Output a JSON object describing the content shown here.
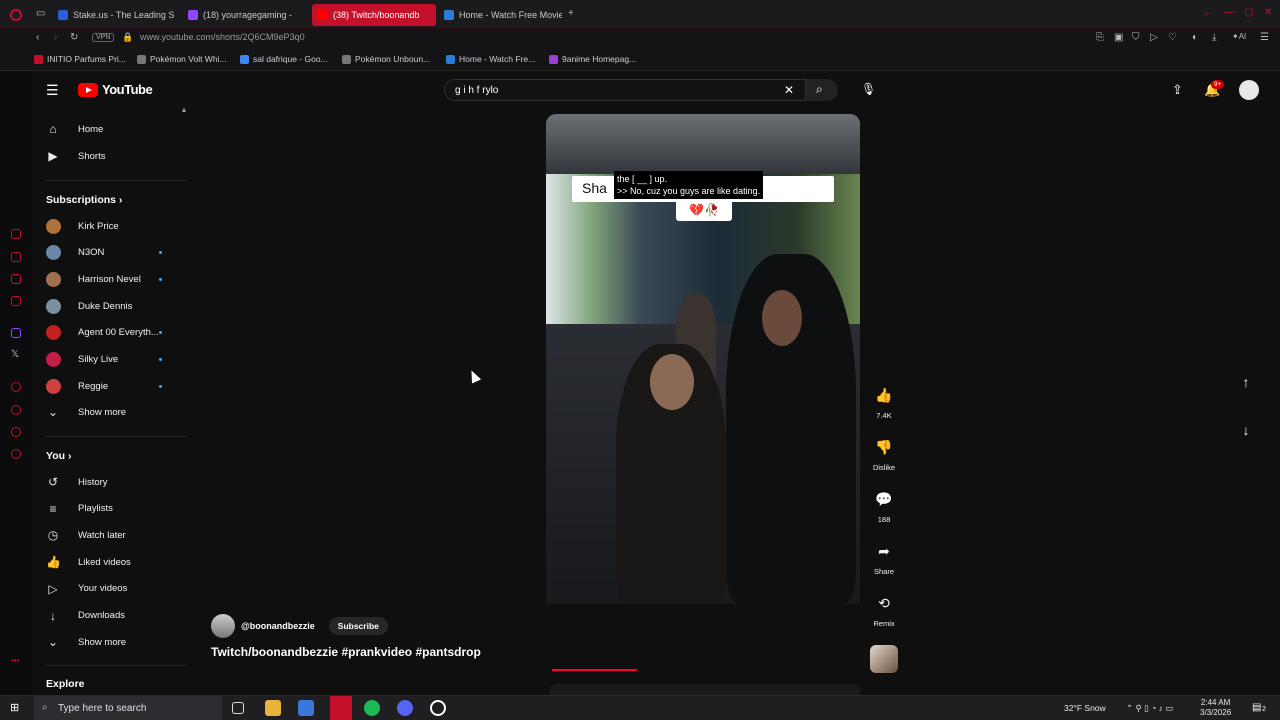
{
  "browser": {
    "tabs": [
      {
        "label": "Stake.us - The Leading So",
        "color": "#2b5fd9"
      },
      {
        "label": "(18) yourragegaming -",
        "color": "#9146ff"
      },
      {
        "label": "(38) Twitch/boonandb",
        "color": "#ff0000",
        "active": true
      },
      {
        "label": "Home - Watch Free Movie",
        "color": "#2b7bd9"
      }
    ],
    "vpn": "VPN",
    "url": "www.youtube.com/shorts/2Q6CM9eP3q0",
    "bookmarks": [
      {
        "label": "INITIO Parfums Pri...",
        "color": "#c4102a"
      },
      {
        "label": "Pokémon Volt Whi...",
        "color": "#777"
      },
      {
        "label": "sal dafrique - Goo...",
        "color": "#4285f4"
      },
      {
        "label": "Pokémon Unboun...",
        "color": "#777"
      },
      {
        "label": "Home - Watch Fre...",
        "color": "#2b7bd9"
      },
      {
        "label": "9anime Homepag...",
        "color": "#9b3fd8"
      }
    ]
  },
  "youtube": {
    "logo": "YouTube",
    "search_value": "g i h f rylo",
    "notif_badge": "9+",
    "sidebar": {
      "top": [
        {
          "label": "Home",
          "icon": "home-icon",
          "glyph": "⌂"
        },
        {
          "label": "Shorts",
          "icon": "shorts-icon",
          "glyph": "▶"
        }
      ],
      "subscriptions_title": "Subscriptions",
      "subscriptions": [
        {
          "label": "Kirk Price",
          "color": "#b0703c",
          "dot": false
        },
        {
          "label": "N3ON",
          "color": "#6a86a8",
          "dot": true
        },
        {
          "label": "Harrison Nevel",
          "color": "#a07050",
          "dot": true
        },
        {
          "label": "Duke Dennis",
          "color": "#7a8fa0",
          "dot": false
        },
        {
          "label": "Agent 00 Everyth...",
          "color": "#c42020",
          "dot": true
        },
        {
          "label": "Silky Live",
          "color": "#c02048",
          "dot": true
        },
        {
          "label": "Reggie",
          "color": "#d04040",
          "dot": true
        }
      ],
      "show_more_1": "Show more",
      "you_title": "You",
      "you_items": [
        {
          "label": "History",
          "icon": "history-icon",
          "glyph": "↺"
        },
        {
          "label": "Playlists",
          "icon": "playlists-icon",
          "glyph": "≡"
        },
        {
          "label": "Watch later",
          "icon": "clock-icon",
          "glyph": "◷"
        },
        {
          "label": "Liked videos",
          "icon": "thumb-up-icon",
          "glyph": "👍"
        },
        {
          "label": "Your videos",
          "icon": "your-videos-icon",
          "glyph": "▷"
        },
        {
          "label": "Downloads",
          "icon": "download-icon",
          "glyph": "↓"
        }
      ],
      "show_more_2": "Show more",
      "explore_title": "Explore"
    },
    "video": {
      "caption_line1": "the [ __ ] up.",
      "caption_line2": ">> No, cuz you guys are like dating.",
      "overlay_text": "Sha",
      "emoji_text": "💔🥀",
      "channel": "@boonandbezzie",
      "subscribe": "Subscribe",
      "title": "Twitch/boonandbezzie #prankvideo #pantsdrop",
      "progress": 0.27
    },
    "actions": {
      "likes": "7.4K",
      "dislike": "Dislike",
      "comments": "188",
      "share": "Share",
      "remix": "Remix"
    }
  },
  "taskbar": {
    "search_placeholder": "Type here to search",
    "weather": "32°F  Snow",
    "time": "2:44 AM",
    "date": "3/3/2026",
    "notif_count": "2"
  }
}
